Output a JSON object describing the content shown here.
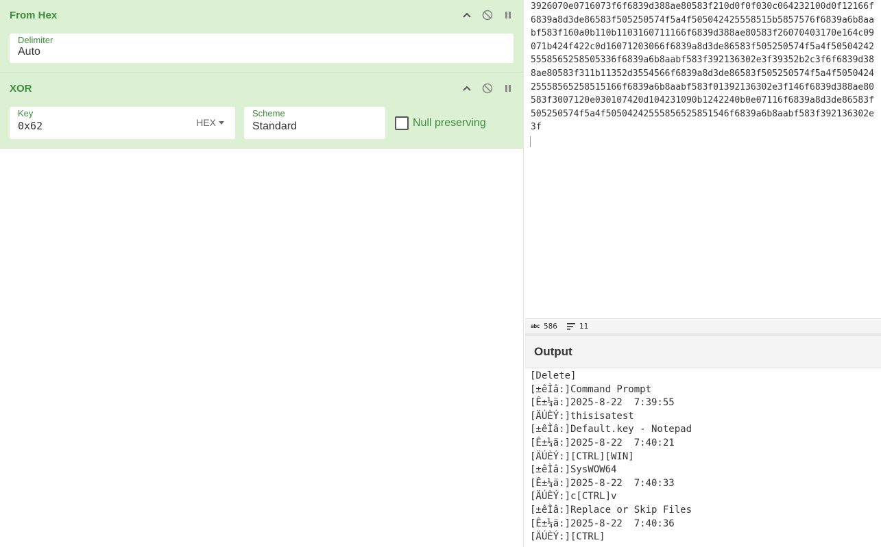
{
  "recipe": {
    "from_hex": {
      "title": "From Hex",
      "delimiter_label": "Delimiter",
      "delimiter_value": "Auto"
    },
    "xor": {
      "title": "XOR",
      "key_label": "Key",
      "key_value": "0x62",
      "key_type": "HEX",
      "scheme_label": "Scheme",
      "scheme_value": "Standard",
      "null_preserving_label": "Null preserving",
      "null_preserving_checked": false
    }
  },
  "input": {
    "text": "3926070e0716073f6f6839d388ae80583f210d0f0f030c064232100d0f12166f6839a8d3de86583f505250574f5a4f505042425558515b5857576f6839a6b8aabf583f160a0b110b1103160711166f6839d388ae80583f26070403170e164c09071b424f422c0d16071203066f6839a8d3de86583f505250574f5a4f505042425558565258505336f6839a6b8aabf583f392136302e3f39352b2c3f6f6839d388ae80583f311b11352d3554566f6839a8d3de86583f505250574f5a4f505042425558565258515166f6839a6b8aabf583f01392136302e3f146f6839d388ae80583f3007120e030107420d104231090b1242240b0e07116f6839a8d3de86583f505250574f5a4f50504242555856525851546f6839a6b8aabf583f392136302e3f"
  },
  "status": {
    "chars_icon": "abc",
    "chars": "586",
    "lines": "11"
  },
  "output": {
    "title": "Output",
    "lines": [
      "[Delete]",
      "[±êÌâ:]Command Prompt",
      "[Ê±¼ä:]2025-8-22  7:39:55",
      "[ÄÚÈÝ:]thisisatest",
      "[±êÌâ:]Default.key - Notepad",
      "[Ê±¼ä:]2025-8-22  7:40:21",
      "[ÄÚÈÝ:][CTRL][WIN]",
      "[±êÌâ:]SysWOW64",
      "[Ê±¼ä:]2025-8-22  7:40:33",
      "[ÄÚÈÝ:]c[CTRL]v",
      "[±êÌâ:]Replace or Skip Files",
      "[Ê±¼ä:]2025-8-22  7:40:36",
      "[ÄÚÈÝ:][CTRL]"
    ]
  },
  "colors": {
    "accent": "#3c8c3a",
    "operation_bg": "#dcf0d4"
  }
}
